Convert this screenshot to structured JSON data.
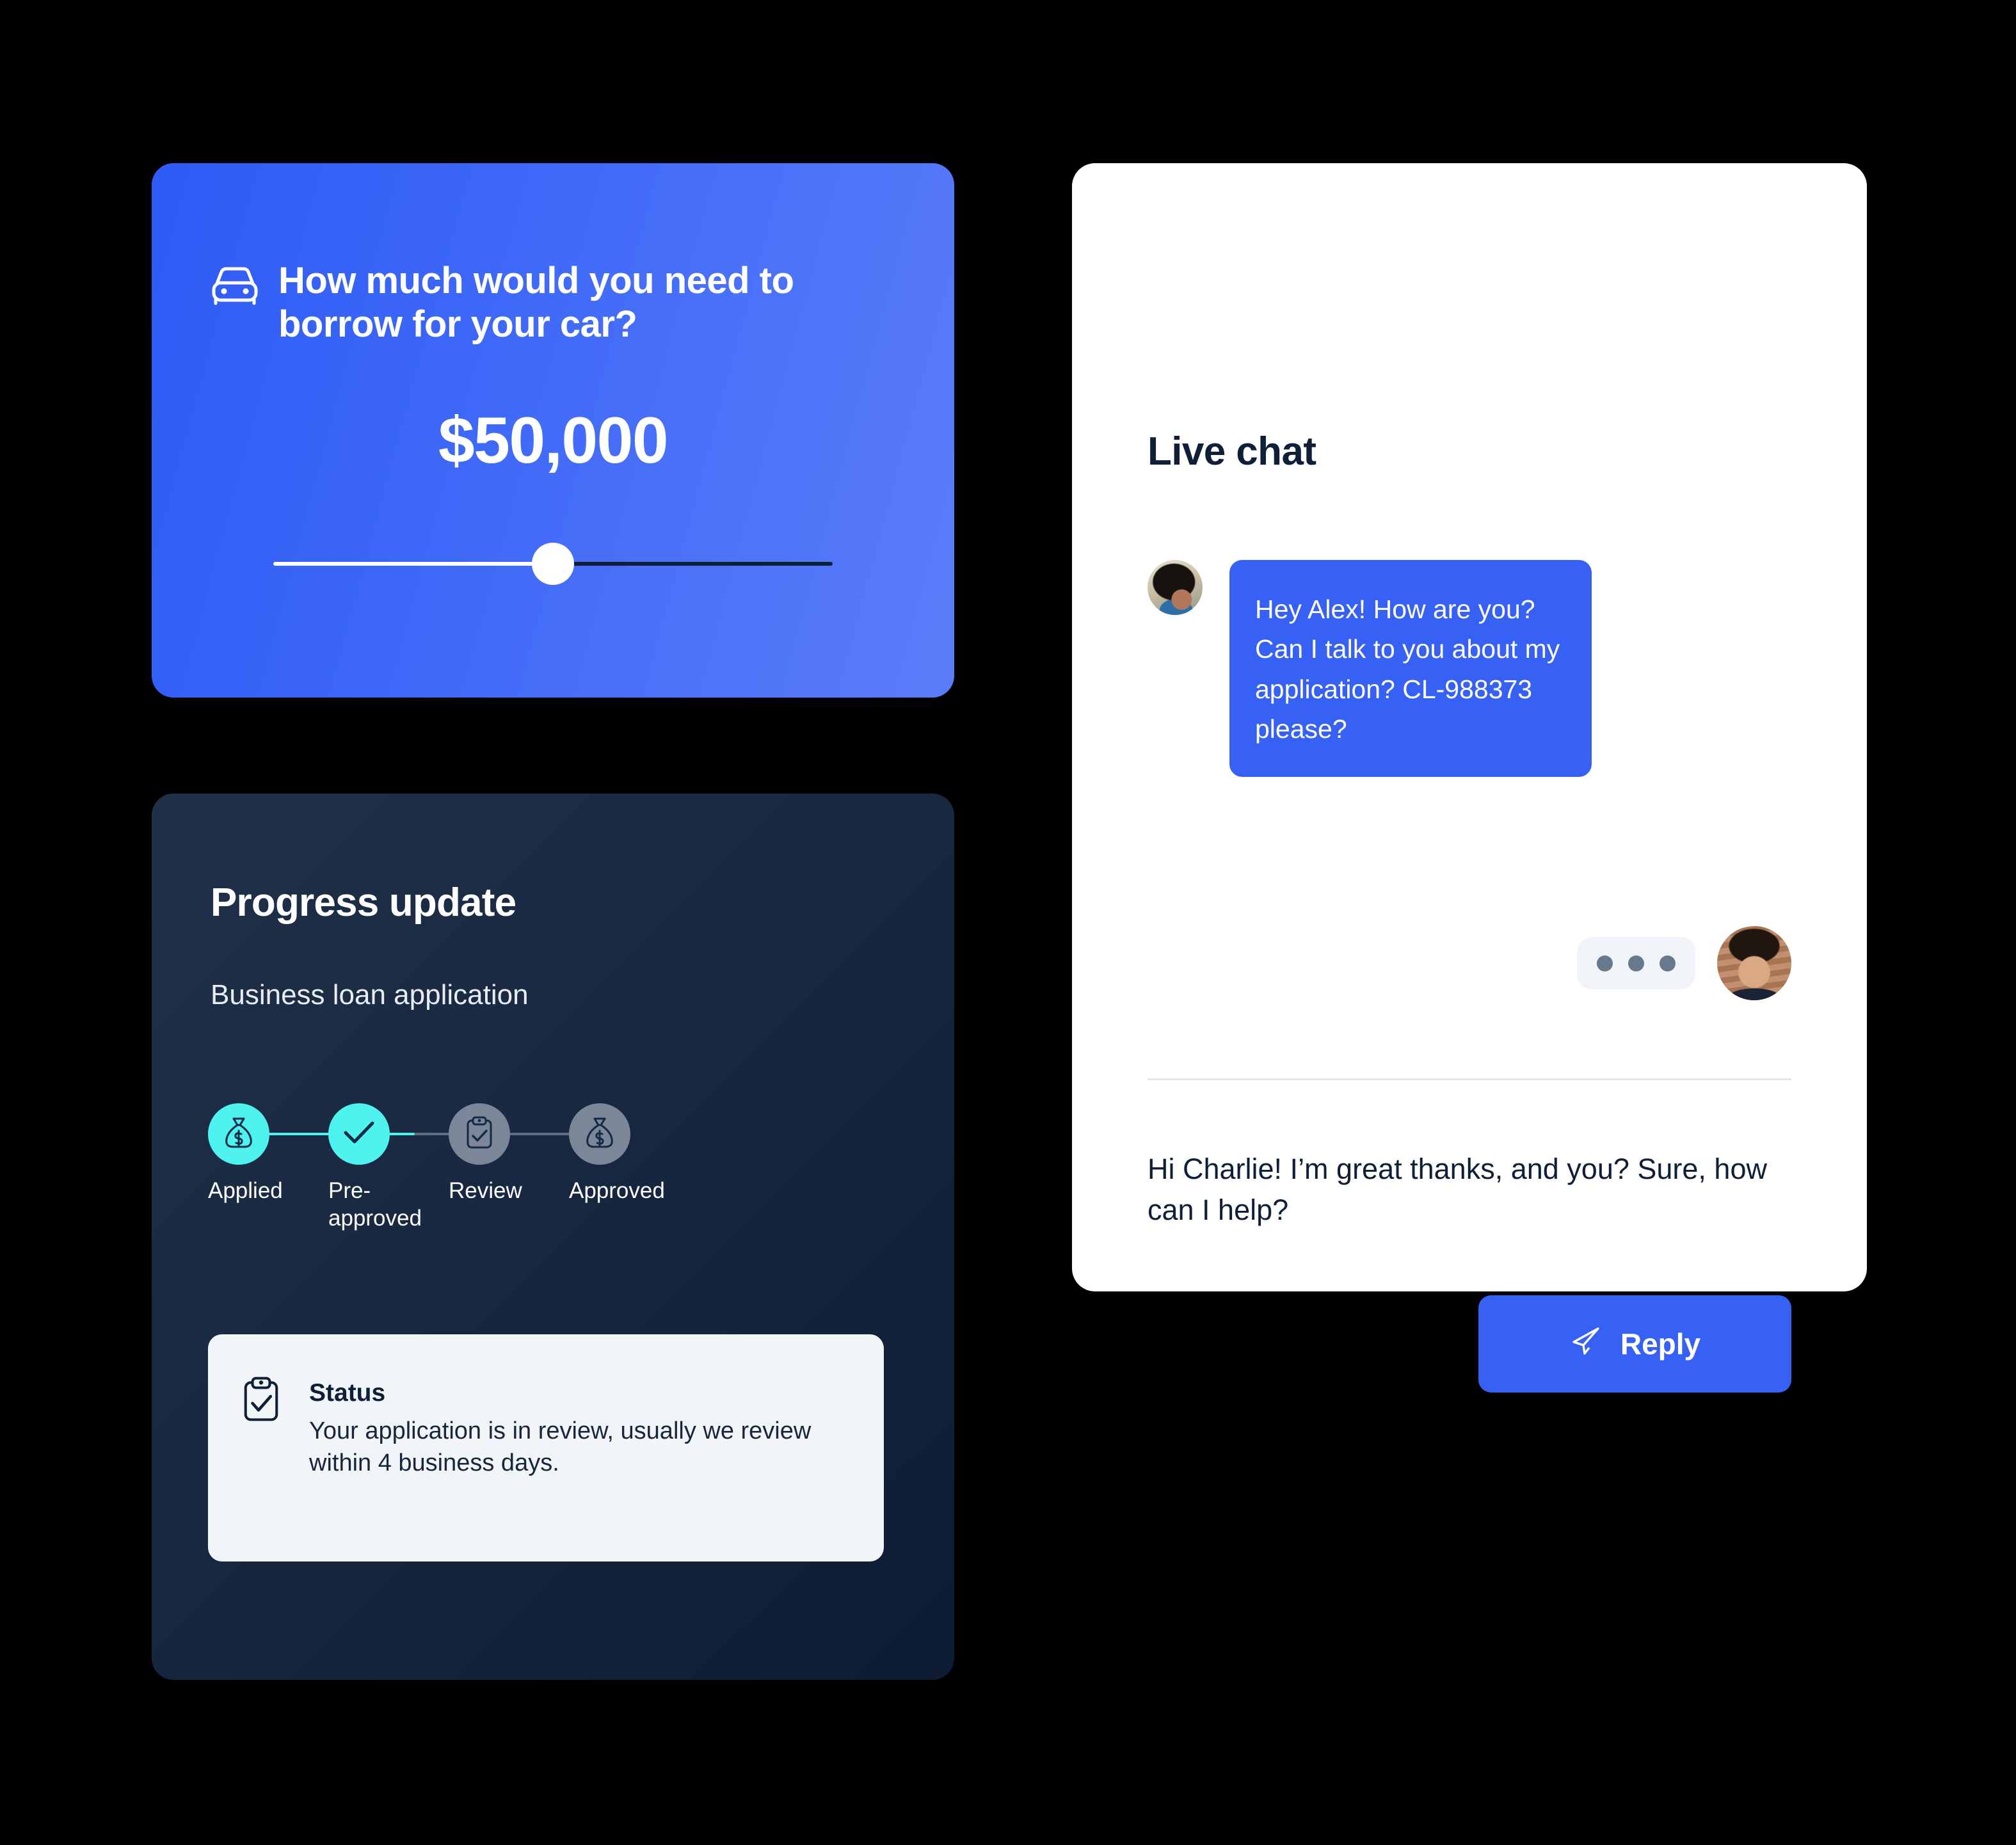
{
  "colors": {
    "page_background": "#000000",
    "brand_blue": "#3761F5",
    "card_blue_start": "#2F5BF6",
    "card_blue_end": "#5B7DF9",
    "dark_navy": "#0F1F38",
    "accent_cyan": "#4EF3F0",
    "muted_gray": "#7B8799",
    "status_box_bg": "#F2F5F8",
    "typing_bubble_bg": "#F0F4F8"
  },
  "borrow_card": {
    "icon": "car-icon",
    "question": "How much would you need to borrow for your car?",
    "amount": "$50,000",
    "slider": {
      "name": "borrow-amount-slider",
      "value_percent": 50,
      "min_label": "",
      "max_label": ""
    }
  },
  "progress_card": {
    "title": "Progress update",
    "subtitle": "Business loan application",
    "steps": [
      {
        "label": "Applied",
        "icon": "money-bag-icon",
        "state": "done"
      },
      {
        "label": "Pre-approved",
        "icon": "check-icon",
        "state": "done"
      },
      {
        "label": "Review",
        "icon": "clipboard-check-icon",
        "state": "todo"
      },
      {
        "label": "Approved",
        "icon": "money-bag-icon",
        "state": "todo"
      }
    ],
    "status": {
      "icon": "clipboard-check-icon",
      "title": "Status",
      "description": "Your application is in review, usually we review within 4 business days."
    }
  },
  "chat_card": {
    "title": "Live chat",
    "incoming_message": {
      "avatar": "avatar-customer",
      "text": "Hey Alex! How are you? Can I talk to you about my application? CL-988373 please?"
    },
    "typing_indicator": {
      "name": "typing-indicator",
      "avatar": "avatar-agent",
      "dots": 3
    },
    "draft_reply": "Hi Charlie! I’m great thanks, and you? Sure, how can I help?",
    "reply_button": {
      "label": "Reply",
      "icon": "send-icon"
    }
  }
}
